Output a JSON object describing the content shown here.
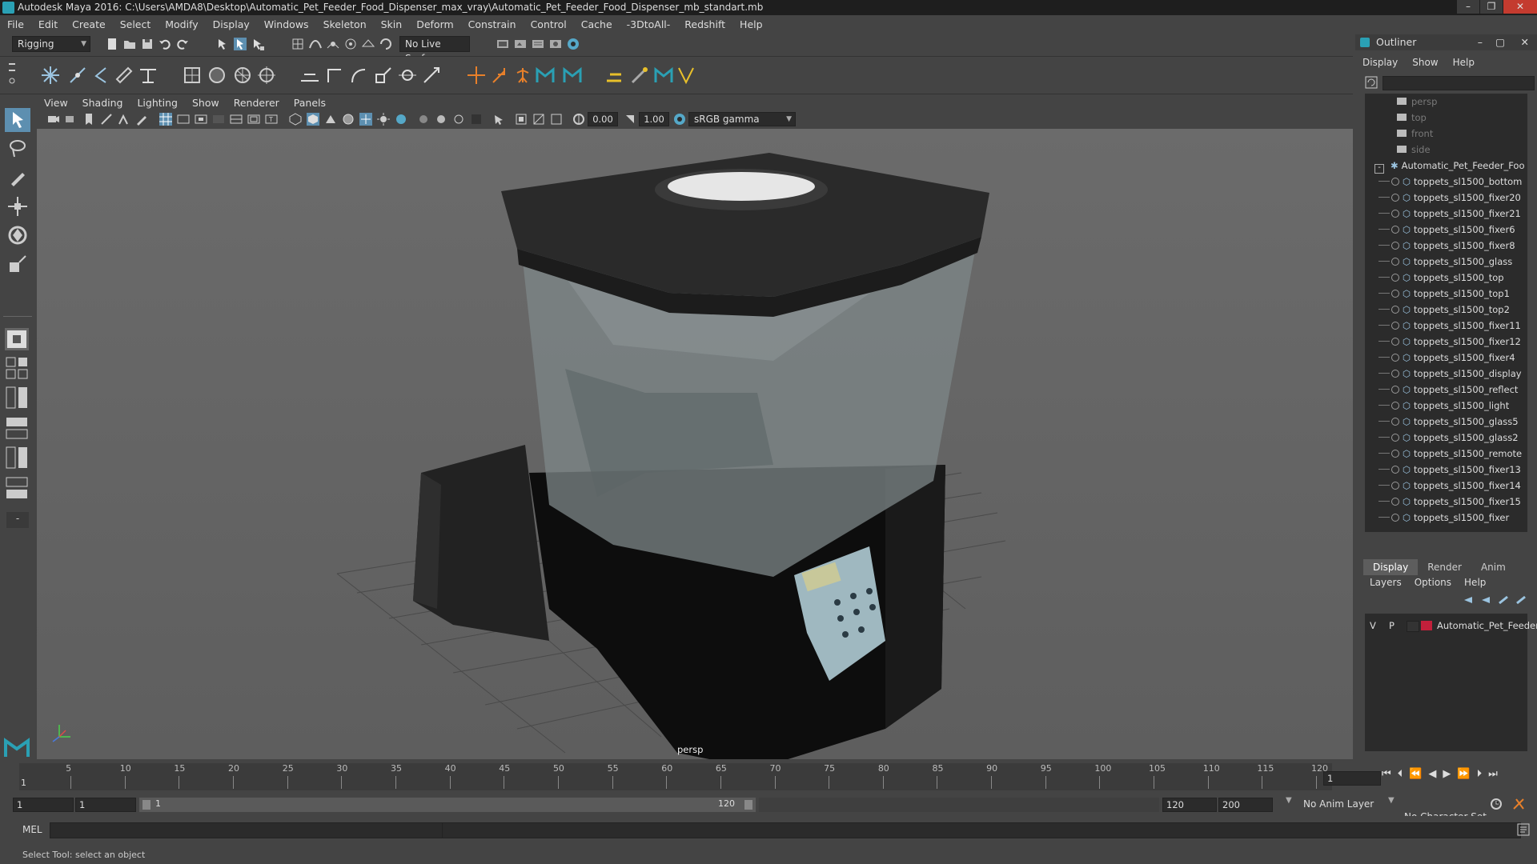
{
  "window": {
    "title": "Autodesk Maya 2016: C:\\Users\\AMDA8\\Desktop\\Automatic_Pet_Feeder_Food_Dispenser_max_vray\\Automatic_Pet_Feeder_Food_Dispenser_mb_standart.mb",
    "minimize": "–",
    "maximize": "❐",
    "close": "✕"
  },
  "menubar": [
    "File",
    "Edit",
    "Create",
    "Select",
    "Modify",
    "Display",
    "Windows",
    "Skeleton",
    "Skin",
    "Deform",
    "Constrain",
    "Control",
    "Cache",
    "-3DtoAll-",
    "Redshift",
    "Help"
  ],
  "status_line": {
    "menuset": "Rigging",
    "live_surface": "No Live Surface"
  },
  "viewport": {
    "menu": [
      "View",
      "Shading",
      "Lighting",
      "Show",
      "Renderer",
      "Panels"
    ],
    "exposure": "0.00",
    "gamma": "1.00",
    "color_space": "sRGB gamma",
    "camera_label": "persp"
  },
  "outliner": {
    "title": "Outliner",
    "menu": [
      "Display",
      "Show",
      "Help"
    ],
    "cameras": [
      "persp",
      "top",
      "front",
      "side"
    ],
    "root": "Automatic_Pet_Feeder_Foo",
    "children": [
      "toppets_sl1500_bottom",
      "toppets_sl1500_fixer20",
      "toppets_sl1500_fixer21",
      "toppets_sl1500_fixer6",
      "toppets_sl1500_fixer8",
      "toppets_sl1500_glass",
      "toppets_sl1500_top",
      "toppets_sl1500_top1",
      "toppets_sl1500_top2",
      "toppets_sl1500_fixer11",
      "toppets_sl1500_fixer12",
      "toppets_sl1500_fixer4",
      "toppets_sl1500_display",
      "toppets_sl1500_reflect",
      "toppets_sl1500_light",
      "toppets_sl1500_glass5",
      "toppets_sl1500_glass2",
      "toppets_sl1500_remote",
      "toppets_sl1500_fixer13",
      "toppets_sl1500_fixer14",
      "toppets_sl1500_fixer15",
      "toppets_sl1500_fixer"
    ]
  },
  "channel_box": {
    "tabs": [
      "Display",
      "Render",
      "Anim"
    ],
    "menu": [
      "Layers",
      "Options",
      "Help"
    ],
    "layer": {
      "v": "V",
      "p": "P",
      "name": "Automatic_Pet_Feeder",
      "color": "#c2203b"
    }
  },
  "timeline": {
    "ticks": [
      "5",
      "10",
      "15",
      "20",
      "25",
      "30",
      "35",
      "40",
      "45",
      "50",
      "55",
      "60",
      "65",
      "70",
      "75",
      "80",
      "85",
      "90",
      "95",
      "100",
      "105",
      "110",
      "115",
      "120"
    ],
    "start_tick": "1",
    "current_frame": "1"
  },
  "range": {
    "start": "1",
    "playback_start": "1",
    "slider_start": "1",
    "slider_end": "120",
    "playback_end": "120",
    "end": "200",
    "anim_layer": "No Anim Layer",
    "character_set": "No Character Set"
  },
  "command_line": {
    "label": "MEL"
  },
  "help_line": "Select Tool: select an object",
  "colors": {
    "accent": "#55a8c8",
    "bg": "#444444",
    "field": "#2b2b2b",
    "layer_red": "#c2203b"
  }
}
